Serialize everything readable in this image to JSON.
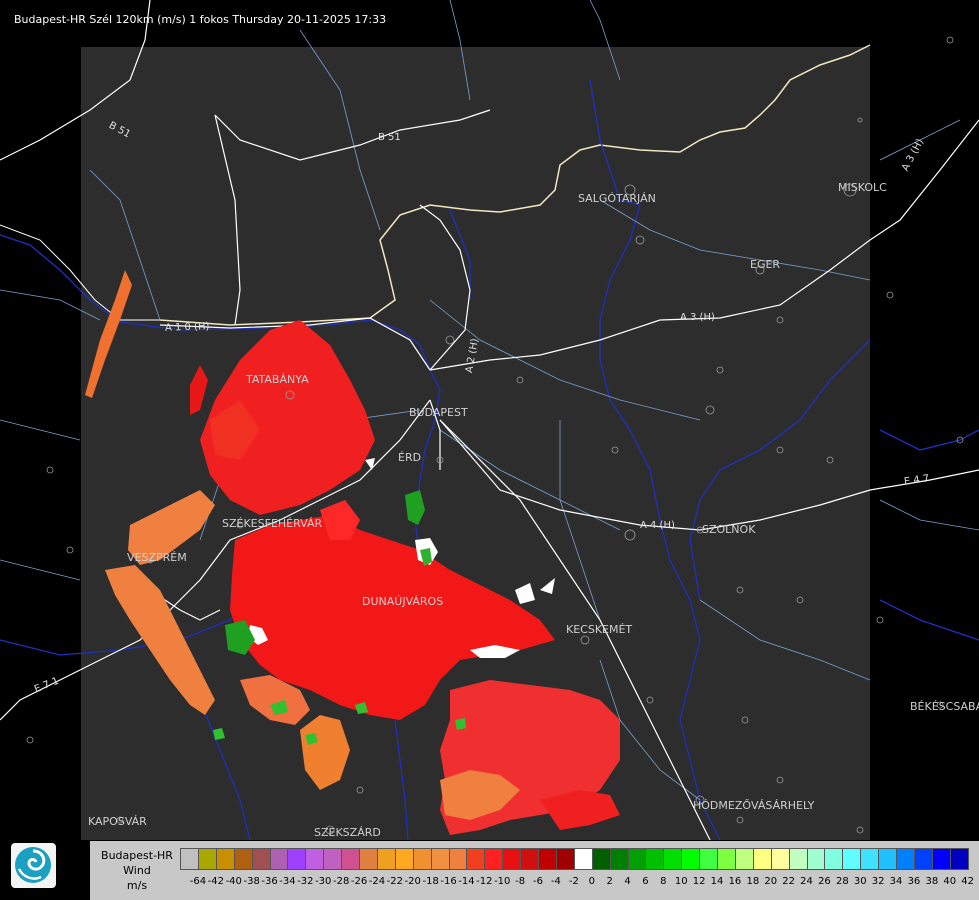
{
  "title": "Budapest-HR Szél 120km (m/s) 1 fokos Thursday 20-11-2025 17:33",
  "cities": [
    {
      "name": "SALGÓTARJÁN",
      "key": "salgotarjan"
    },
    {
      "name": "MISKOLC",
      "key": "miskolc"
    },
    {
      "name": "EGER",
      "key": "eger"
    },
    {
      "name": "TATABÁNYA",
      "key": "tatabanya"
    },
    {
      "name": "BUDAPEST",
      "key": "budapest"
    },
    {
      "name": "ÉRD",
      "key": "erd"
    },
    {
      "name": "SZÉKESFEHÉRVÁR",
      "key": "szekesfehervar"
    },
    {
      "name": "VESZPRÉM",
      "key": "veszprem"
    },
    {
      "name": "DUNAÚJVÁROS",
      "key": "dunaujvaros"
    },
    {
      "name": "KECSKEMÉT",
      "key": "kecskemet"
    },
    {
      "name": "SZOLNOK",
      "key": "szolnok"
    },
    {
      "name": "BÉKÉSCSABA",
      "key": "bekescsaba"
    },
    {
      "name": "HÓDMEZŐVÁSÁRHELY",
      "key": "hodmezovasarhely"
    },
    {
      "name": "KAPOSVÁR",
      "key": "kaposvar"
    },
    {
      "name": "SZEKSZÁRD",
      "key": "szekszard"
    }
  ],
  "roads": [
    {
      "name": "B 51",
      "key": "b51a"
    },
    {
      "name": "B 51",
      "key": "b51b"
    },
    {
      "name": "A 1 0 (H)",
      "key": "a10"
    },
    {
      "name": "A 2 (H)",
      "key": "a2"
    },
    {
      "name": "A 3 (H)",
      "key": "a3"
    },
    {
      "name": "A 3 (H)",
      "key": "a3b"
    },
    {
      "name": "A 4 (H)",
      "key": "a4"
    },
    {
      "name": "E 4 7",
      "key": "e47"
    },
    {
      "name": "E 7 1",
      "key": "e71"
    }
  ],
  "legend": {
    "line1": "Budapest-HR",
    "line2": "Wind",
    "line3": "m/s",
    "ticks": [
      "-64",
      "-42",
      "-40",
      "-38",
      "-36",
      "-34",
      "-32",
      "-30",
      "-28",
      "-26",
      "-24",
      "-22",
      "-20",
      "-18",
      "-16",
      "-14",
      "-12",
      "-10",
      "-8",
      "-6",
      "-4",
      "-2",
      "0",
      "2",
      "4",
      "6",
      "8",
      "10",
      "12",
      "14",
      "16",
      "18",
      "20",
      "22",
      "24",
      "26",
      "28",
      "30",
      "32",
      "34",
      "36",
      "38",
      "40",
      "42"
    ],
    "colors": [
      "#c0c0c0",
      "#a8a800",
      "#c89000",
      "#b06010",
      "#a05050",
      "#b060b0",
      "#a040ff",
      "#c060e0",
      "#c060c0",
      "#d05090",
      "#e08040",
      "#f0a020",
      "#ffa820",
      "#f09030",
      "#f09040",
      "#f08040",
      "#f04020",
      "#ff2020",
      "#e81010",
      "#d01010",
      "#c00000",
      "#a00000",
      "#ffffff",
      "#006000",
      "#008000",
      "#00a000",
      "#00c000",
      "#00e000",
      "#00ff00",
      "#40ff40",
      "#80ff40",
      "#c0ff80",
      "#ffff80",
      "#ffffa0",
      "#c0ffc0",
      "#a0ffd0",
      "#80ffe0",
      "#60ffff",
      "#40e0ff",
      "#20c0ff",
      "#0080ff",
      "#0040ff",
      "#0000ff",
      "#0000c0"
    ]
  },
  "logo_icon": "radar-service-logo-icon"
}
